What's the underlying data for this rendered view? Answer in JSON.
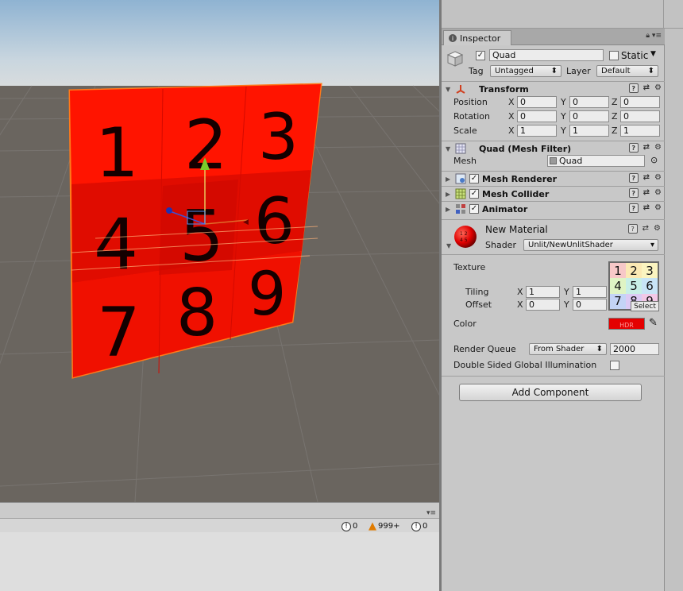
{
  "scene": {
    "quad_digits": [
      "1",
      "2",
      "3",
      "4",
      "5",
      "6",
      "7",
      "8",
      "9"
    ]
  },
  "console": {
    "info_count": "0",
    "warning_count": "999+",
    "error_count": "0"
  },
  "inspector": {
    "tab_label": "Inspector",
    "object_name": "Quad",
    "static_label": "Static",
    "tag_label": "Tag",
    "tag_value": "Untagged",
    "layer_label": "Layer",
    "layer_value": "Default",
    "transform": {
      "title": "Transform",
      "position_label": "Position",
      "rotation_label": "Rotation",
      "scale_label": "Scale",
      "x": "X",
      "y": "Y",
      "z": "Z",
      "position": [
        "0",
        "0",
        "0"
      ],
      "rotation": [
        "0",
        "0",
        "0"
      ],
      "scale": [
        "1",
        "1",
        "1"
      ]
    },
    "mesh_filter": {
      "title": "Quad (Mesh Filter)",
      "mesh_label": "Mesh",
      "mesh_value": "Quad"
    },
    "mesh_renderer": {
      "title": "Mesh Renderer"
    },
    "mesh_collider": {
      "title": "Mesh Collider"
    },
    "animator": {
      "title": "Animator"
    },
    "material": {
      "name": "New Material",
      "shader_label": "Shader",
      "shader_value": "Unlit/NewUnlitShader",
      "texture_label": "Texture",
      "tiling_label": "Tiling",
      "offset_label": "Offset",
      "x": "X",
      "y": "Y",
      "tiling": [
        "1",
        "1"
      ],
      "offset": [
        "0",
        "0"
      ],
      "select_label": "Select",
      "texture_digits": [
        "1",
        "2",
        "3",
        "4",
        "5",
        "6",
        "7",
        "8",
        "9"
      ],
      "color_label": "Color",
      "color_value": "#e40000",
      "hdr_label": "HDR",
      "render_queue_label": "Render Queue",
      "render_queue_mode": "From Shader",
      "render_queue_value": "2000",
      "dsgi_label": "Double Sided Global Illumination"
    },
    "add_component_label": "Add Component"
  }
}
